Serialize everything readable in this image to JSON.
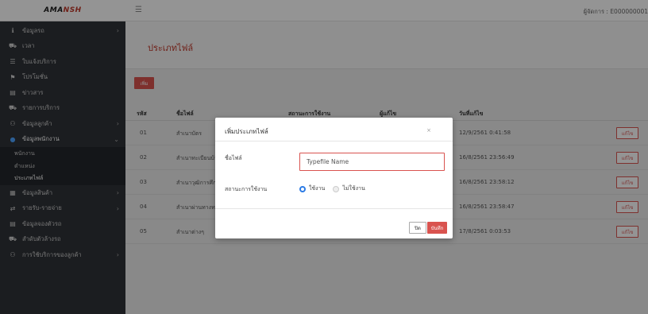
{
  "brand": {
    "logo_part1": "AMA",
    "logo_part2": "NSH"
  },
  "topbar": {
    "user": "ผู้จัดการ : E000000001"
  },
  "sidebar": {
    "items": [
      {
        "icon": "ℹ",
        "label": "ข้อมูลรถ",
        "arrow": "›"
      },
      {
        "icon": "⛟",
        "label": "เวลา",
        "arrow": ""
      },
      {
        "icon": "☰",
        "label": "ใบแจ้งบริการ",
        "arrow": ""
      },
      {
        "icon": "⚑",
        "label": "โปรโมชั่น",
        "arrow": ""
      },
      {
        "icon": "▤",
        "label": "ข่าวสาร",
        "arrow": ""
      },
      {
        "icon": "⛟",
        "label": "รายการบริการ",
        "arrow": ""
      },
      {
        "icon": "⚇",
        "label": "ข้อมูลลูกค้า",
        "arrow": "›"
      },
      {
        "icon": "●",
        "label": "ข้อมูลพนักงาน",
        "arrow": "⌄"
      }
    ],
    "subitems": [
      {
        "label": "พนักงาน"
      },
      {
        "label": "ตำแหน่ง"
      },
      {
        "label": "ประเภทไฟล์"
      }
    ],
    "items_after": [
      {
        "icon": "▦",
        "label": "ข้อมูลสินค้า",
        "arrow": "›"
      },
      {
        "icon": "⇄",
        "label": "รายรับ-รายจ่าย",
        "arrow": "›"
      },
      {
        "icon": "▤",
        "label": "ข้อมูลจองตัวรถ",
        "arrow": ""
      },
      {
        "icon": "⛟",
        "label": "สำดับตัวล้างรถ",
        "arrow": ""
      },
      {
        "icon": "⚇",
        "label": "การใช้บริการของลูกค้า",
        "arrow": "›"
      }
    ]
  },
  "page": {
    "title": "ประเภทไฟล์",
    "add_label": "เพิ่ม"
  },
  "table": {
    "headers": [
      "รหัส",
      "ชื่อไฟล์",
      "สถานะการใช้งาน",
      "ผู้แก้ไข",
      "วันที่แก้ไข"
    ],
    "rows": [
      {
        "id": "01",
        "name": "สำเนาบัตร",
        "date": "12/9/2561 0:41:58",
        "edit": "แก้ไข"
      },
      {
        "id": "02",
        "name": "สำเนาทะเบียนบ้าน",
        "date": "16/8/2561 23:56:49",
        "edit": "แก้ไข"
      },
      {
        "id": "03",
        "name": "สำเนาวุฒิการศึกษา",
        "date": "16/8/2561 23:58:12",
        "edit": "แก้ไข"
      },
      {
        "id": "04",
        "name": "สำเนาผ่านทางทหาร",
        "date": "16/8/2561 23:58:47",
        "edit": "แก้ไข"
      },
      {
        "id": "05",
        "name": "สำเนาต่างๆ",
        "date": "17/8/2561 0:03:53",
        "edit": "แก้ไข"
      }
    ]
  },
  "modal": {
    "title": "เพิ่มประเภทไฟล์",
    "close_x": "×",
    "name_label": "ชื่อไฟล์",
    "name_placeholder": "Typefile Name",
    "status_label": "สถานะการใช้งาน",
    "radio_on": "ใช้งาน",
    "radio_off": "ไม่ใช้งาน",
    "close_label": "ปิด",
    "save_label": "บันทึก"
  },
  "colors": {
    "accent": "#d9534f",
    "sidebar": "#2f3237",
    "radio": "#2c7be5"
  }
}
